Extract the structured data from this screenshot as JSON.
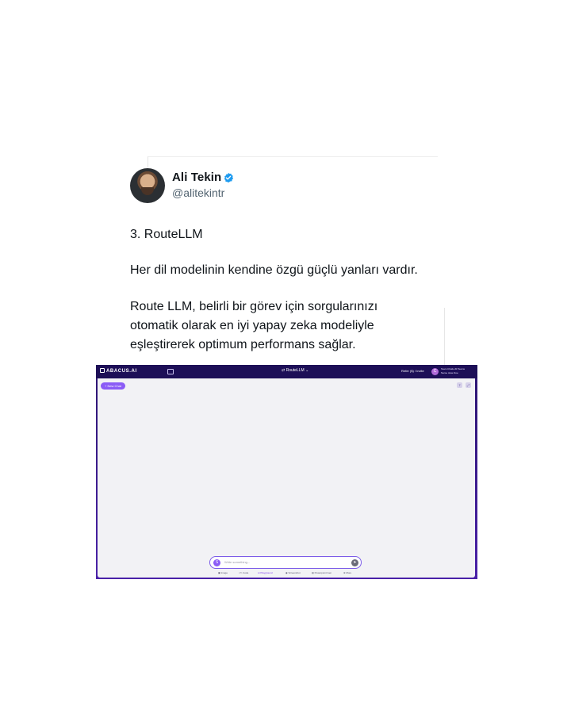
{
  "tweet": {
    "author": {
      "name": "Ali Tekin",
      "handle": "@alitekintr",
      "verified_icon": "verified-badge-icon",
      "avatar_icon": "profile-photo"
    },
    "lines": [
      "3. RouteLLM",
      "Her dil modelinin kendine özgü güçlü yanları vardır.",
      "Route LLM, belirli bir görev için sorgularınızı",
      "otomatik olarak en iyi yapay zeka modeliyle",
      "eşleştirerek optimum performans sağlar."
    ]
  },
  "app": {
    "brand": "ABACUS.AI",
    "model_select": "RouteLLM",
    "refer_label": "Refer ($) / Invite",
    "user_initial": "C",
    "user_team": "Team ChatLLM Teams",
    "user_name": "Name Jane Doe",
    "new_chat_label": "+ New Chat",
    "input_placeholder": "Write something...",
    "input_avatar_initial": "S",
    "tools": [
      "Image",
      "Code",
      "Playground",
      "Screenshot",
      "Powerpoint Gen",
      "More"
    ],
    "active_tool": "Playground",
    "colors": {
      "header": "#1d0f57",
      "accent": "#8b5cf6",
      "canvas": "#f2f2f5"
    }
  }
}
